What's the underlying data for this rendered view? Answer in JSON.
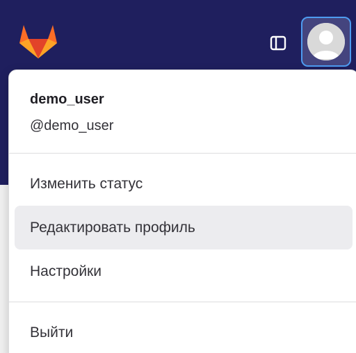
{
  "colors": {
    "topbar_bg": "#1f1f5e",
    "accent_focus": "#4e9cf1",
    "hover_bg": "#ececef"
  },
  "header": {
    "logo_icon": "gitlab-tanuki-icon",
    "sidebar_toggle_icon": "sidebar-toggle-icon",
    "avatar_icon": "user-avatar-icon"
  },
  "dropdown": {
    "user": {
      "name": "demo_user",
      "handle": "@demo_user"
    },
    "items": [
      {
        "label": "Изменить статус"
      },
      {
        "label": "Редактировать профиль",
        "hovered": true
      },
      {
        "label": "Настройки"
      }
    ],
    "signout_label": "Выйти"
  }
}
